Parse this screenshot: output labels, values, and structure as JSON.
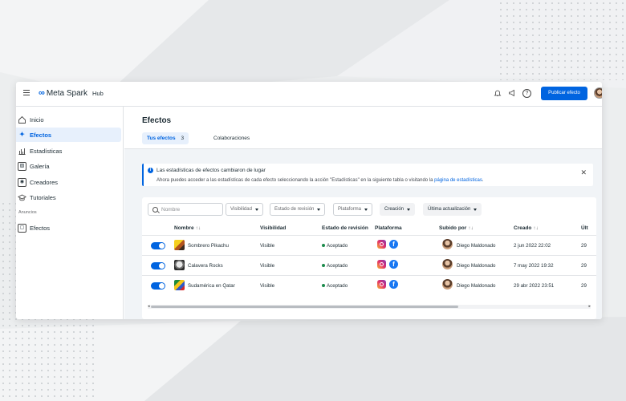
{
  "header": {
    "brand_name": "Meta Spark",
    "brand_suffix": "Hub",
    "publish_label": "Publicar efecto",
    "help_glyph": "?"
  },
  "sidebar": {
    "items": [
      {
        "label": "Inicio",
        "icon": "home-icon"
      },
      {
        "label": "Efectos",
        "icon": "effects-sparkle-icon",
        "active": true
      },
      {
        "label": "Estadísticas",
        "icon": "bar-chart-icon"
      },
      {
        "label": "Galería",
        "icon": "gallery-icon"
      },
      {
        "label": "Creadores",
        "icon": "creators-icon"
      },
      {
        "label": "Tutoriales",
        "icon": "graduation-cap-icon"
      }
    ],
    "section_label": "Anuncios",
    "ads_item": {
      "label": "Efectos",
      "icon": "ads-effects-icon"
    }
  },
  "main": {
    "title": "Efectos",
    "tabs": [
      {
        "label": "Tus efectos",
        "count": "3",
        "active": true
      },
      {
        "label": "Colaboraciones"
      }
    ],
    "banner": {
      "title": "Las estadísticas de efectos cambiaron de lugar",
      "text": "Ahora puedes acceder a las estadísticas de cada efecto seleccionando la acción \"Estadísticas\" en la siguiente tabla o visitando la",
      "link": "página de estadísticas",
      "suffix": "."
    },
    "filters": {
      "search_placeholder": "Nombre",
      "visibility": "Visibilidad",
      "review_state": "Estado de revisión",
      "platform": "Plataforma",
      "creation": "Creación",
      "last_update": "Última actualización"
    },
    "columns": {
      "name": "Nombre",
      "visibility": "Visibilidad",
      "review_state": "Estado de revisión",
      "platform": "Plataforma",
      "uploaded_by": "Subido por",
      "created": "Creado",
      "updated": "Últ",
      "sort_glyph": "↑↓"
    },
    "rows": [
      {
        "name": "Sombrero Pikachu",
        "visibility": "Visible",
        "status": "Aceptado",
        "uploaded_by": "Diego Maldonado",
        "created": "2 jun 2022 22:02",
        "updated": "29"
      },
      {
        "name": "Calavera Rocks",
        "visibility": "Visible",
        "status": "Aceptado",
        "uploaded_by": "Diego Maldonado",
        "created": "7 may 2022 19:32",
        "updated": "29"
      },
      {
        "name": "Sudamérica en Qatar",
        "visibility": "Visible",
        "status": "Aceptado",
        "uploaded_by": "Diego Maldonado",
        "created": "29 abr 2022 23:51",
        "updated": "29"
      }
    ]
  },
  "colors": {
    "accent": "#0064e0",
    "status_ok": "#1b8a4b",
    "facebook": "#1877f2"
  }
}
